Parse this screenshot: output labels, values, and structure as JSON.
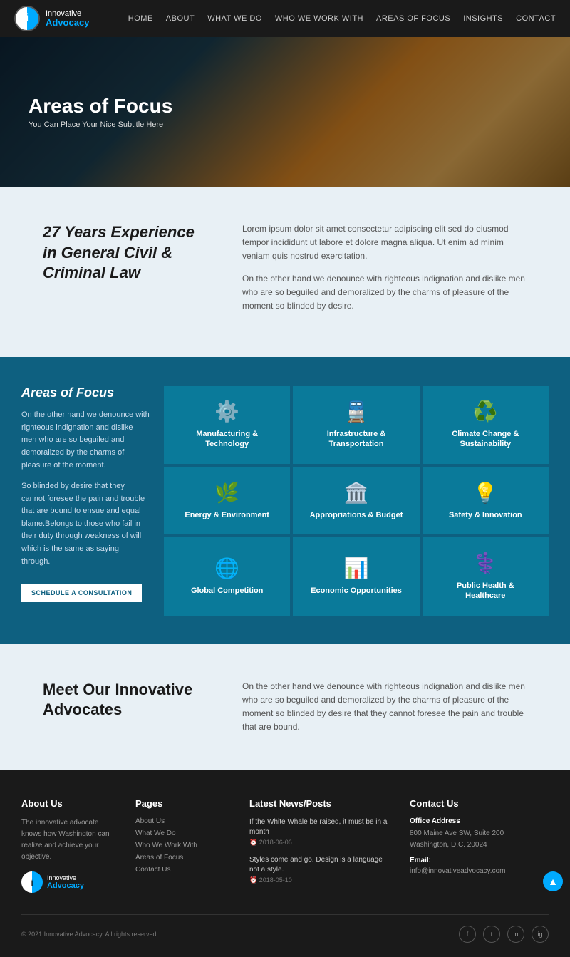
{
  "header": {
    "logo_top": "Innovative",
    "logo_bottom": "Advocacy",
    "nav": [
      "HOME",
      "ABOUT",
      "WHAT WE DO",
      "WHO WE WORK WITH",
      "AREAS OF FOCUS",
      "INSIGHTS",
      "CONTACT"
    ]
  },
  "hero": {
    "title": "Areas of Focus",
    "subtitle": "You Can Place Your Nice Subtitle Here"
  },
  "intro": {
    "heading": "27 Years Experience in General Civil & Criminal Law",
    "para1": "Lorem ipsum dolor sit amet consectetur adipiscing elit sed do eiusmod tempor incididunt ut labore et dolore magna aliqua. Ut enim ad minim veniam quis nostrud exercitation.",
    "para2": "On the other hand we denounce with righteous indignation and dislike men who are so beguiled and demoralized by the charms of pleasure of the moment so blinded by desire."
  },
  "focus": {
    "heading": "Areas of Focus",
    "description1": "On the other hand we denounce with righteous indignation and dislike men who are so beguiled and demoralized by the charms of pleasure of the moment.",
    "description2": "So blinded by desire that they cannot foresee the pain and trouble that are bound to ensue and equal blame.Belongs to those who fail in their duty through weakness of will which is the same as saying through.",
    "button": "SCHEDULE A CONSULTATION",
    "cards": [
      {
        "icon": "⚙",
        "label": "Manufacturing &\nTechnology"
      },
      {
        "icon": "🚆",
        "label": "Infrastructure &\nTransportation"
      },
      {
        "icon": "♻",
        "label": "Climate Change &\nSustainability"
      },
      {
        "icon": "🌿",
        "label": "Energy & Environment"
      },
      {
        "icon": "🏛",
        "label": "Appropriations & Budget"
      },
      {
        "icon": "💡",
        "label": "Safety & Innovation"
      },
      {
        "icon": "🌐",
        "label": "Global Competition"
      },
      {
        "icon": "📊",
        "label": "Economic Opportunities"
      },
      {
        "icon": "⚕",
        "label": "Public Health &\nHealthcare"
      }
    ]
  },
  "meet": {
    "heading": "Meet Our Innovative Advocates",
    "description": "On the other hand we denounce with righteous indignation and dislike men who are so beguiled and demoralized by the charms of pleasure of the moment so blinded by desire that they cannot foresee the pain and trouble that are bound."
  },
  "footer": {
    "about_heading": "About Us",
    "about_text": "The innovative advocate knows how Washington can realize and achieve your objective.",
    "pages_heading": "Pages",
    "pages_links": [
      "About Us",
      "What We Do",
      "Who We Work With",
      "Areas of Focus",
      "Contact Us"
    ],
    "news_heading": "Latest News/Posts",
    "news_items": [
      {
        "title": "If the White Whale be raised, it must be in a month",
        "date": "2018-06-06"
      },
      {
        "title": "Styles come and go. Design is a language not a style.",
        "date": "2018-05-10"
      }
    ],
    "contact_heading": "Contact Us",
    "office_label": "Office Address",
    "address": "800 Maine Ave SW, Suite 200\nWashington, D.C. 20024",
    "email_label": "Email:",
    "email": "info@innovativeadvocacy.com",
    "copyright": "© 2021 Innovative Advocacy. All rights reserved.",
    "social": [
      "f",
      "t",
      "in",
      "ig"
    ]
  }
}
